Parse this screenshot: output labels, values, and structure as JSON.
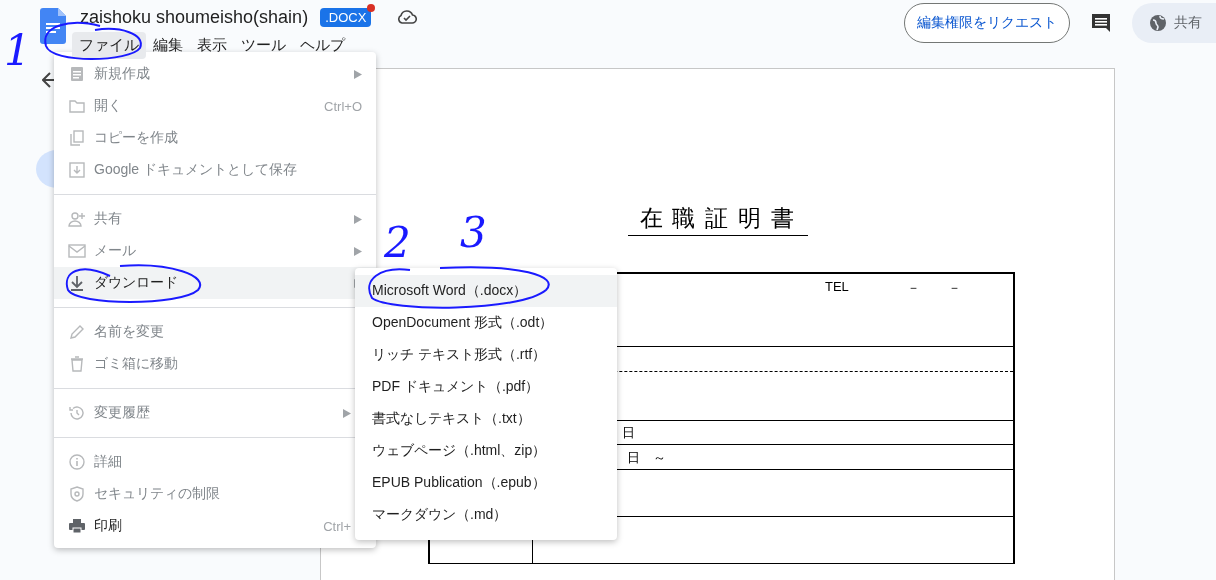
{
  "top_bar": {
    "doc_title": "zaishoku shoumeisho(shain)",
    "badge": ".DOCX",
    "badge_alert": true,
    "menu": [
      {
        "label": "ファイル",
        "selected": true
      },
      {
        "label": "編集",
        "selected": false
      },
      {
        "label": "表示",
        "selected": false
      },
      {
        "label": "ツール",
        "selected": false
      },
      {
        "label": "ヘルプ",
        "selected": false
      }
    ],
    "request_button": "編集権限をリクエスト",
    "share_button": "共有"
  },
  "document": {
    "title": "在 職 証 明 書",
    "rows": [
      {
        "kind": "contact",
        "texts": [
          "TEL",
          "－",
          "－"
        ]
      },
      {
        "kind": "split"
      },
      {
        "kind": "date",
        "texts": [
          "日"
        ]
      },
      {
        "kind": "period",
        "texts": [
          "日",
          "～"
        ]
      },
      {
        "kind": "blank"
      },
      {
        "kind": "blank"
      }
    ]
  },
  "file_menu": {
    "sections": [
      [
        {
          "label": "新規作成",
          "has_submenu": true,
          "disabled": true,
          "selected": false
        },
        {
          "label": "開く",
          "shortcut": "Ctrl+O",
          "has_submenu": false,
          "disabled": true,
          "selected": false
        },
        {
          "label": "コピーを作成",
          "has_submenu": false,
          "disabled": true,
          "selected": false
        },
        {
          "label": "Google ドキュメントとして保存",
          "has_submenu": false,
          "disabled": true,
          "selected": false
        }
      ],
      [
        {
          "label": "共有",
          "has_submenu": true,
          "disabled": true,
          "selected": false
        },
        {
          "label": "メール",
          "has_submenu": true,
          "disabled": true,
          "selected": false
        },
        {
          "label": "ダウンロード",
          "has_submenu": true,
          "disabled": false,
          "selected": true
        }
      ],
      [
        {
          "label": "名前を変更",
          "has_submenu": false,
          "disabled": true,
          "selected": false
        },
        {
          "label": "ゴミ箱に移動",
          "has_submenu": false,
          "disabled": true,
          "selected": false
        }
      ],
      [
        {
          "label": "変更履歴",
          "has_submenu": true,
          "disabled": true,
          "selected": false
        }
      ],
      [
        {
          "label": "詳細",
          "has_submenu": false,
          "disabled": true,
          "selected": false
        },
        {
          "label": "セキュリティの制限",
          "has_submenu": false,
          "disabled": true,
          "selected": false
        },
        {
          "label": "印刷",
          "shortcut": "Ctrl+",
          "has_submenu": false,
          "disabled": false,
          "selected": false
        }
      ]
    ]
  },
  "download_menu": [
    {
      "label": "Microsoft Word（.docx）",
      "selected": true
    },
    {
      "label": "OpenDocument 形式（.odt）",
      "selected": false
    },
    {
      "label": "リッチ テキスト形式（.rtf）",
      "selected": false
    },
    {
      "label": "PDF ドキュメント（.pdf）",
      "selected": false
    },
    {
      "label": "書式なしテキスト（.txt）",
      "selected": false
    },
    {
      "label": "ウェブページ（.html、zip）",
      "selected": false
    },
    {
      "label": "EPUB Publication（.epub）",
      "selected": false
    },
    {
      "label": "マークダウン（.md）",
      "selected": false
    }
  ],
  "annotations": [
    {
      "label": "1"
    },
    {
      "label": "2"
    },
    {
      "label": "3"
    }
  ]
}
